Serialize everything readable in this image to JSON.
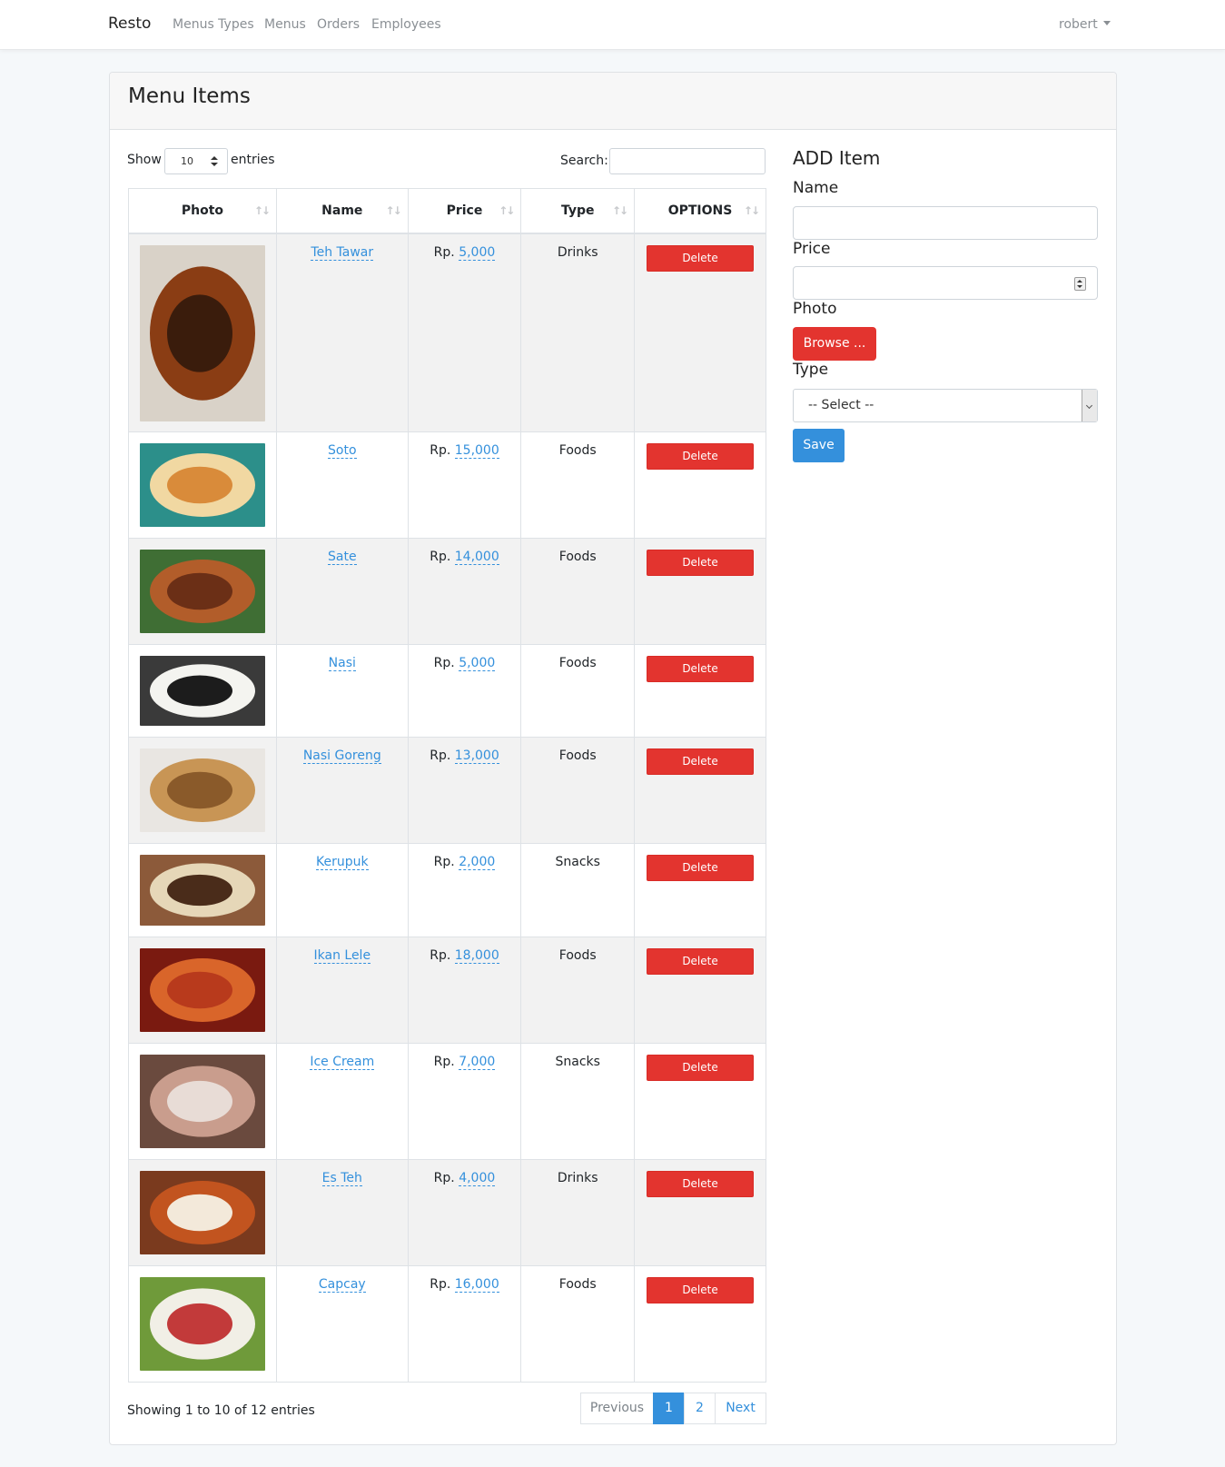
{
  "navbar": {
    "brand": "Resto",
    "links": [
      "Menus Types",
      "Menus",
      "Orders",
      "Employees"
    ],
    "user": "robert"
  },
  "card": {
    "title": "Menu Items"
  },
  "table_controls": {
    "show_label": "Show",
    "page_length": "10",
    "entries_label": "entries",
    "search_label": "Search:"
  },
  "table": {
    "headers": [
      "Photo",
      "Name",
      "Price",
      "Type",
      "OPTIONS"
    ],
    "price_prefix": "Rp.",
    "delete_label": "Delete",
    "rows": [
      {
        "name": "Teh Tawar",
        "price": "5,000",
        "type": "Drinks",
        "photo_icon": "iced-tea-photo",
        "colors": [
          "#3a1c0c",
          "#8a3d14",
          "#d9d2c8"
        ]
      },
      {
        "name": "Soto",
        "price": "15,000",
        "type": "Foods",
        "photo_icon": "soto-photo",
        "colors": [
          "#d98b3a",
          "#f1d8a2",
          "#2c8f8a"
        ]
      },
      {
        "name": "Sate",
        "price": "14,000",
        "type": "Foods",
        "photo_icon": "satay-photo",
        "colors": [
          "#6b2f16",
          "#b25d2a",
          "#3f6e34"
        ]
      },
      {
        "name": "Nasi",
        "price": "5,000",
        "type": "Foods",
        "photo_icon": "rice-photo",
        "colors": [
          "#1c1c1c",
          "#f4f4f0",
          "#3a3a3a"
        ]
      },
      {
        "name": "Nasi Goreng",
        "price": "13,000",
        "type": "Foods",
        "photo_icon": "fried-rice-photo",
        "colors": [
          "#8a5a2a",
          "#c89555",
          "#e9e6e2"
        ]
      },
      {
        "name": "Kerupuk",
        "price": "2,000",
        "type": "Snacks",
        "photo_icon": "crackers-photo",
        "colors": [
          "#4a2c1a",
          "#e6d7b8",
          "#8c5a3a"
        ]
      },
      {
        "name": "Ikan Lele",
        "price": "18,000",
        "type": "Foods",
        "photo_icon": "grilled-fish-photo",
        "colors": [
          "#b83a1c",
          "#d9652a",
          "#7a1a10"
        ]
      },
      {
        "name": "Ice Cream",
        "price": "7,000",
        "type": "Snacks",
        "photo_icon": "ice-cream-photo",
        "colors": [
          "#e8dcd6",
          "#c99d8d",
          "#6a4a3e"
        ]
      },
      {
        "name": "Es Teh",
        "price": "4,000",
        "type": "Drinks",
        "photo_icon": "es-teh-photo",
        "colors": [
          "#f3e9da",
          "#c2541f",
          "#7a3a1e"
        ]
      },
      {
        "name": "Capcay",
        "price": "16,000",
        "type": "Foods",
        "photo_icon": "capcay-photo",
        "colors": [
          "#c23a3a",
          "#f1efe6",
          "#6f9a3a"
        ]
      }
    ]
  },
  "table_footer": {
    "info": "Showing 1 to 10 of 12 entries",
    "previous": "Previous",
    "pages": [
      "1",
      "2"
    ],
    "next": "Next"
  },
  "add_form": {
    "title": "ADD Item",
    "name_label": "Name",
    "price_label": "Price",
    "photo_label": "Photo",
    "browse_label": "Browse ...",
    "type_label": "Type",
    "type_selected": "-- Select --",
    "save_label": "Save"
  },
  "colors": {
    "primary": "#3490dc",
    "danger": "#e3342f",
    "stripe": "#f2f2f2"
  }
}
